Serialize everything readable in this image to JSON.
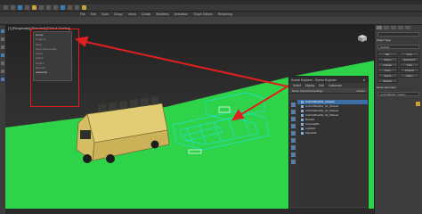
{
  "menubar": {
    "items": [
      "File",
      "Edit",
      "Tools",
      "Group",
      "Views",
      "Create",
      "Modifiers",
      "Animation",
      "Graph Editors",
      "Rendering"
    ]
  },
  "viewport": {
    "label": "[+] [Perspective] [Standard] [Default Shading]"
  },
  "popup_menu": {
    "items": [
      {
        "label": "Group",
        "active": true
      },
      {
        "label": "Ungroup",
        "active": false
      },
      {
        "label": "Open",
        "active": false
      },
      {
        "label": "Open Recursively",
        "active": false
      },
      {
        "label": "Close",
        "active": false
      },
      {
        "label": "Attach",
        "active": false
      },
      {
        "label": "Detach",
        "active": false
      },
      {
        "label": "Explode",
        "active": false
      },
      {
        "label": "Assembly",
        "active": true
      }
    ]
  },
  "scene_explorer": {
    "title": "Scene Explorer - Scene Explorer",
    "close_icon": "close-icon",
    "menu": [
      "Select",
      "Display",
      "Edit",
      "Customize"
    ],
    "column_header": "Name (Sorted Ascending)",
    "column_header_right": "Frozen",
    "rows": [
      {
        "label": "ArchVizBus001_Chassis",
        "selected": true
      },
      {
        "label": "ArchVizBus001_01_Wheels",
        "selected": false
      },
      {
        "label": "ArchVizBus001_02_Wheels",
        "selected": false
      },
      {
        "label": "ArchVizBus001_03_Wheels",
        "selected": false
      },
      {
        "label": "Box001",
        "selected": false
      },
      {
        "label": "Camera001",
        "selected": false
      },
      {
        "label": "Light001",
        "selected": false
      },
      {
        "label": "Plane001",
        "selected": false
      }
    ],
    "footer_name": "Scene Explorer",
    "footer_selection": "Selection Set:"
  },
  "command_panel": {
    "section_object_type": "Object Type",
    "autogrid": "AutoGrid",
    "buttons": [
      "Box",
      "Cone",
      "Sphere",
      "GeoSphere",
      "Cylinder",
      "Tube",
      "Torus",
      "Pyramid",
      "Teapot",
      "Plane",
      "TextPlus"
    ],
    "section_name_color": "Name and Color",
    "name_value": "ArchVizBus001_Chassis"
  },
  "colors": {
    "ground": "#2fd34a",
    "highlight_red": "#e02020",
    "selection_cyan": "#20e0d0",
    "bus_yellow": "#e2cd74"
  }
}
